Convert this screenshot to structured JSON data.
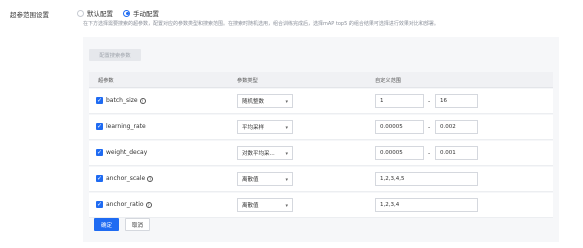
{
  "header": {
    "label": "超参范围设置",
    "radio_default": "默认配置",
    "radio_manual": "手动配置",
    "description": "在下方选择需要搜索的超参数，配置对应的参数类型和搜索范围。在搜索时随机选用，组合训练完成后，选择mAP top5 的组合结果可选择进行效果对比和部署。"
  },
  "config_button": "配置搜索参数",
  "table": {
    "col_param": "超参数",
    "col_type": "参数类型",
    "col_range": "自定义范围"
  },
  "rows": [
    {
      "name": "batch_size",
      "type": "随机整数",
      "min": "1",
      "max": "16",
      "help": true
    },
    {
      "name": "learning_rate",
      "type": "平均采样",
      "min": "0.00005",
      "max": "0.002",
      "help": false
    },
    {
      "name": "weight_decay",
      "type": "对数平均采...",
      "min": "0.00005",
      "max": "0.001",
      "help": false
    },
    {
      "name": "anchor_scale",
      "type": "离散值",
      "value": "1,2,3,4,5",
      "help": true
    },
    {
      "name": "anchor_ratio",
      "type": "离散值",
      "value": "1,2,3,4",
      "help": true
    }
  ],
  "actions": {
    "confirm": "确定",
    "cancel": "取消"
  },
  "colors": {
    "accent": "#1f6bf2",
    "panel_bg": "#f6f7f9"
  },
  "icons": {
    "checkbox": "checkmark-icon",
    "help": "question-circle-icon",
    "chevron": "chevron-down-icon"
  }
}
